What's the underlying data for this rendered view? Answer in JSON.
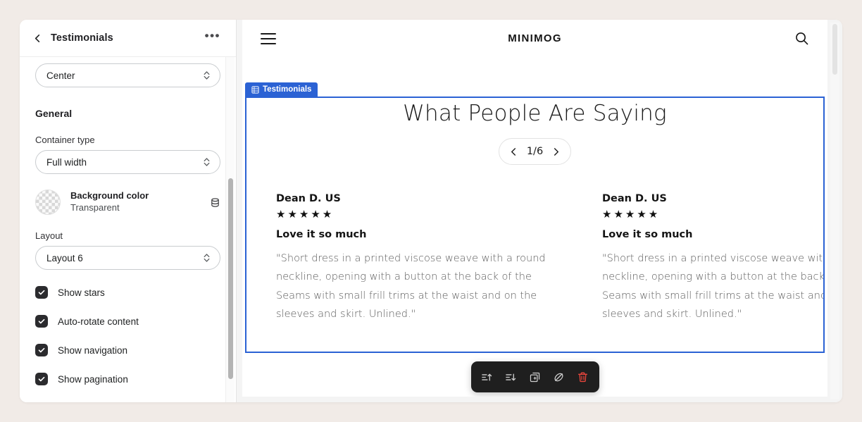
{
  "sidebar": {
    "title": "Testimonials",
    "back_icon": "chevron-left-icon",
    "more_icon": "ellipsis-icon",
    "alignment_select": {
      "value": "Center"
    },
    "general_heading": "General",
    "container_type": {
      "label": "Container type",
      "value": "Full width"
    },
    "background_color": {
      "name": "Background color",
      "value": "Transparent",
      "source_icon": "database-icon"
    },
    "layout": {
      "label": "Layout",
      "value": "Layout 6"
    },
    "checkboxes": [
      {
        "label": "Show stars",
        "checked": true
      },
      {
        "label": "Auto-rotate content",
        "checked": true
      },
      {
        "label": "Show navigation",
        "checked": true
      },
      {
        "label": "Show pagination",
        "checked": true
      }
    ]
  },
  "preview": {
    "store_header": {
      "menu_icon": "hamburger-icon",
      "logo": "MINIMOG",
      "search_icon": "search-icon"
    },
    "section_badge": {
      "label": "Testimonials",
      "icon": "section-grid-icon",
      "color": "#2b62d4"
    },
    "section": {
      "title": "What People Are Saying",
      "pagination": {
        "prev_icon": "chevron-left-icon",
        "counter": "1/6",
        "next_icon": "chevron-right-icon"
      },
      "testimonials": [
        {
          "author": "Dean D. US",
          "stars": "★★★★★",
          "heading": "Love it so much",
          "body": "\"Short dress in a printed viscose weave with a round neckline, opening with a button at the back of the Seams with small frill trims at the waist and on the sleeves and skirt. Unlined.\""
        },
        {
          "author": "Dean D. US",
          "stars": "★★★★★",
          "heading": "Love it so much",
          "body": "\"Short dress in a printed viscose weave with a round neckline, opening with a button at the back of the Seams with small frill trims at the waist and on the sleeves and skirt. Unlined.\""
        }
      ]
    },
    "toolbar": {
      "buttons": [
        {
          "name": "move-up-icon",
          "label": "Move up"
        },
        {
          "name": "move-down-icon",
          "label": "Move down"
        },
        {
          "name": "duplicate-icon",
          "label": "Duplicate"
        },
        {
          "name": "hide-icon",
          "label": "Hide"
        },
        {
          "name": "delete-icon",
          "label": "Delete"
        }
      ]
    }
  }
}
